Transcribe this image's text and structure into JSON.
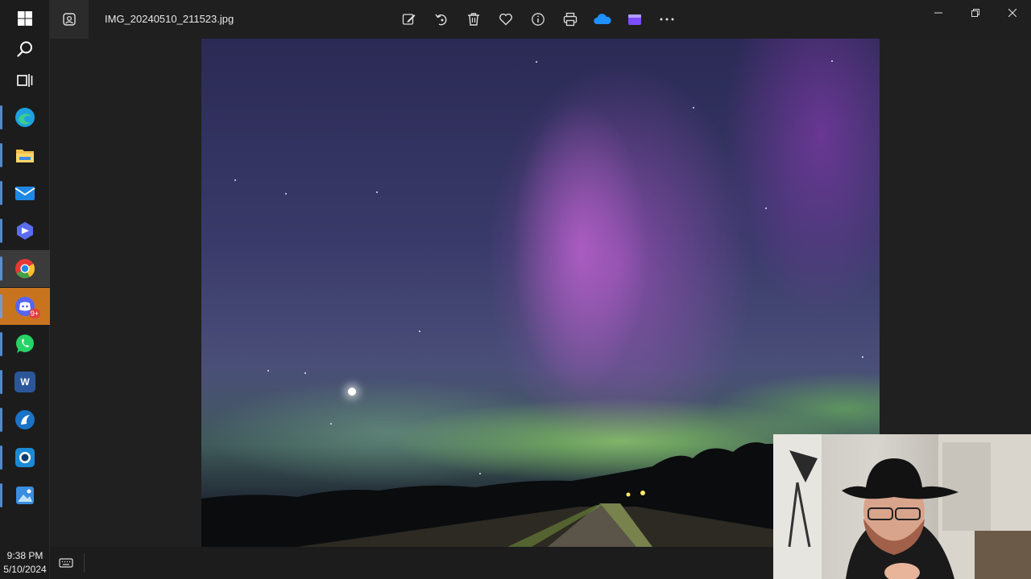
{
  "window": {
    "file_name": "IMG_20240510_211523.jpg"
  },
  "toolbar": {
    "items": [
      {
        "id": "edit",
        "icon": "edit-image-icon"
      },
      {
        "id": "rotate",
        "icon": "rotate-icon"
      },
      {
        "id": "delete",
        "icon": "trash-icon"
      },
      {
        "id": "favorite",
        "icon": "heart-icon"
      },
      {
        "id": "info",
        "icon": "info-icon"
      },
      {
        "id": "print",
        "icon": "print-icon"
      },
      {
        "id": "onedrive",
        "icon": "cloud-icon",
        "color": "#1e90ff"
      },
      {
        "id": "clipchamp",
        "icon": "video-editor-icon",
        "color": "#7c4dff"
      },
      {
        "id": "more",
        "icon": "more-icon"
      }
    ]
  },
  "taskbar": {
    "apps": [
      {
        "id": "start",
        "icon": "windows-start-icon"
      },
      {
        "id": "search",
        "icon": "search-icon"
      },
      {
        "id": "task-view",
        "icon": "task-view-icon"
      },
      {
        "id": "edge",
        "icon": "edge-icon",
        "color": "#1fa0e0"
      },
      {
        "id": "explorer",
        "icon": "folder-icon",
        "color": "#f2c14e"
      },
      {
        "id": "mail",
        "icon": "mail-icon",
        "color": "#1e88e5"
      },
      {
        "id": "copilot",
        "icon": "copilot-icon",
        "color": "#5b6cf0"
      },
      {
        "id": "chrome",
        "icon": "chrome-icon",
        "color": "#e53935"
      },
      {
        "id": "discord",
        "icon": "discord-icon",
        "color": "#5865f2",
        "badge": "9+"
      },
      {
        "id": "whatsapp",
        "icon": "whatsapp-icon",
        "color": "#25d366"
      },
      {
        "id": "word",
        "icon": "word-icon",
        "color": "#2b579a",
        "letter": "W"
      },
      {
        "id": "browser",
        "icon": "browser-icon",
        "color": "#1a73c8"
      },
      {
        "id": "camera",
        "icon": "camera-app-icon",
        "color": "#1b8ad6"
      },
      {
        "id": "photos",
        "icon": "photos-icon",
        "color": "#3a8de0"
      }
    ]
  },
  "clock": {
    "time": "9:38 PM",
    "date": "5/10/2024"
  },
  "colors": {
    "taskbar_bg": "#1c1c1c",
    "titlebar_bg": "#1f1f1f",
    "flash_highlight": "#c8741f"
  }
}
